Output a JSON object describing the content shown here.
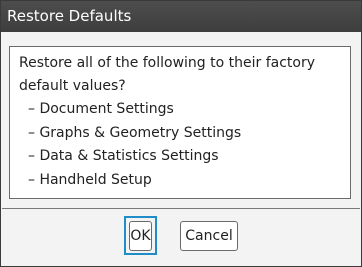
{
  "dialog": {
    "title": "Restore Defaults",
    "message_line1": "Restore all of the following to their factory",
    "message_line2": "default values?",
    "items": [
      "– Document Settings",
      "– Graphs & Geometry Settings",
      "– Data & Statistics Settings",
      "– Handheld Setup"
    ],
    "ok_label": "OK",
    "cancel_label": "Cancel",
    "focused_button": "OK"
  },
  "colors": {
    "titlebar": "#444444",
    "focus_ring": "#1f8ec8",
    "dialog_background": "#f3f3f3"
  }
}
